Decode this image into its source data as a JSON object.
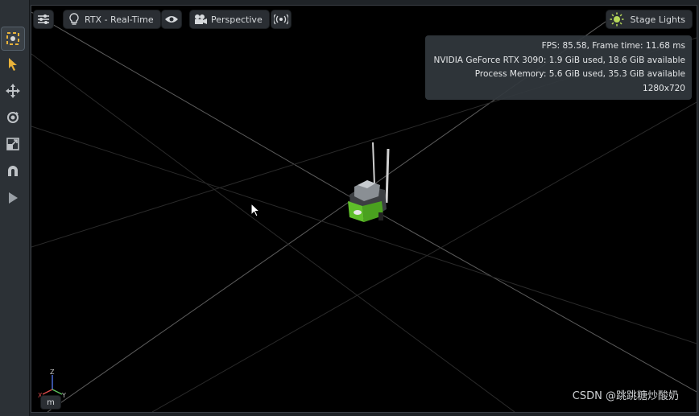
{
  "toolbar": {
    "tools": [
      {
        "icon": "select-mode-icon"
      },
      {
        "icon": "pointer-icon"
      },
      {
        "icon": "move-icon"
      },
      {
        "icon": "rotate-icon"
      },
      {
        "icon": "scale-icon"
      },
      {
        "icon": "snap-magnet-icon"
      },
      {
        "icon": "play-icon"
      }
    ]
  },
  "viewport": {
    "settings_icon": "settings-sliders-icon",
    "render_mode": {
      "icon": "lightbulb-icon",
      "label": "RTX - Real-Time"
    },
    "visibility_icon": "eye-icon",
    "camera": {
      "icon": "camera-icon",
      "label": "Perspective"
    },
    "audio_icon": "broadcast-icon",
    "lights": {
      "icon": "sun-icon",
      "label": "Stage Lights"
    },
    "stats": {
      "fps_line": "FPS: 85.58, Frame time: 11.68 ms",
      "gpu_line": "NVIDIA GeForce RTX 3090: 1.9 GiB used, 18.6 GiB available",
      "process_line": "Process Memory: 5.6 GiB used, 35.3 GiB available",
      "resolution": "1280x720"
    },
    "axis_labels": {
      "z": "Z",
      "x": "X",
      "y": "Y"
    },
    "unit_label": "m"
  },
  "watermark": "CSDN @跳跳糖炒酸奶",
  "colors": {
    "accent_yellow": "#e8b23a",
    "robot_green": "#5fbf2a",
    "grid_line": "#6a6a6a"
  }
}
